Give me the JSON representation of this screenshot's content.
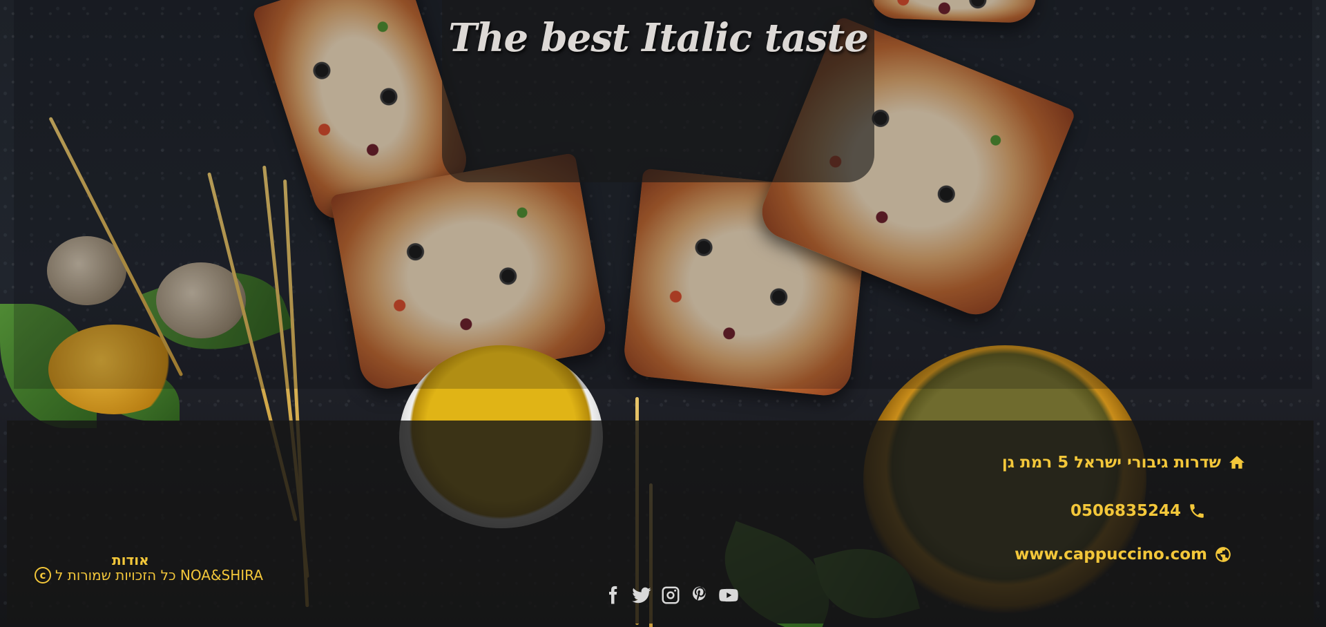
{
  "header": {
    "title": "The best Italic taste"
  },
  "footer": {
    "contact": {
      "address": "שדרות גיבורי ישראל 5 רמת גן",
      "phone": "0506835244",
      "website": "www.cappuccino.com"
    },
    "about": {
      "title": "אודות",
      "copyright": "כל הזכויות שמורות ל NOA&SHIRA"
    },
    "social_icons": [
      "facebook-icon",
      "twitter-icon",
      "instagram-icon",
      "pinterest-icon",
      "youtube-icon"
    ]
  },
  "colors": {
    "accent": "#f3c73a",
    "footer_bg": "#161616",
    "title_text": "#ddd9d6",
    "social_icon": "#d9d9d9"
  }
}
